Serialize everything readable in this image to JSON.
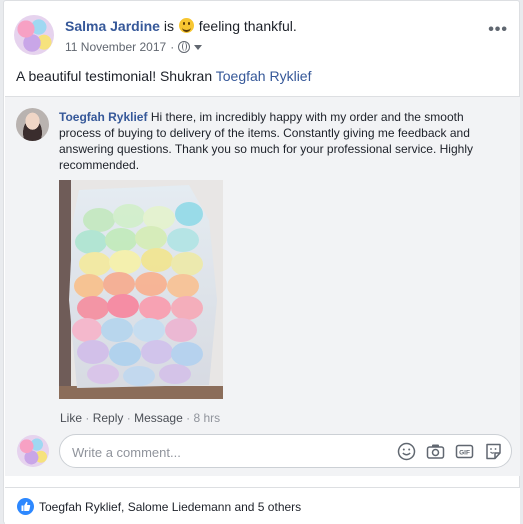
{
  "post": {
    "author": "Salma Jardine",
    "is_word": "is",
    "feeling_text": "feeling thankful.",
    "date": "11 November 2017",
    "text_prefix": "A beautiful testimonial! Shukran",
    "tagged_name": "Toegfah Ryklief",
    "privacy_icon": "globe-icon",
    "options_glyph": "•••"
  },
  "comment": {
    "author": "Toegfah Ryklief",
    "text": "Hi there, im incredibly happy with my order and the smooth process of buying to delivery of the items. Constantly giving me feedback and answering questions. Thank you so much for your professional service. Highly recommended.",
    "like_label": "Like",
    "reply_label": "Reply",
    "message_label": "Message",
    "separator": "·",
    "time": "8 hrs"
  },
  "composer": {
    "placeholder": "Write a comment...",
    "icons": [
      "emoji-icon",
      "camera-icon",
      "gif-icon",
      "sticker-icon"
    ]
  },
  "reactions": {
    "icon": "like-thumb-icon",
    "text": "Toegfah Ryklief, Salome Liedemann and 5 others"
  },
  "colors": {
    "link": "#365899",
    "like_blue": "#2d88ff",
    "comment_bg": "#f2f3f5"
  }
}
